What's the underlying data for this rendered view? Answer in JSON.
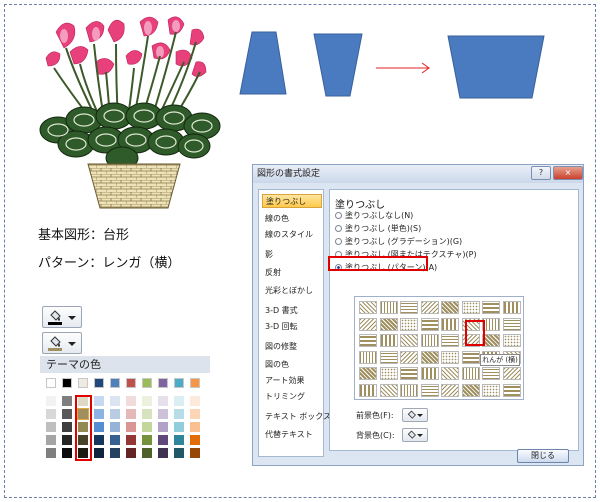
{
  "captions": {
    "shape_label": "基本図形：台形",
    "pattern_label": "パターン：レンガ（横）"
  },
  "colors": {
    "shape_fill": "#4a7abf",
    "arrow": "#e02020",
    "highlight": "#e00000",
    "pattern_fg": "#a09060"
  },
  "palette": {
    "title": "テーマの色",
    "top_row": [
      "#ffffff",
      "#000000",
      "#eeece1",
      "#1f497d",
      "#4f81bd",
      "#c0504d",
      "#9bbb59",
      "#8064a2",
      "#4bacc6",
      "#f79646"
    ],
    "shades": [
      [
        "#f2f2f2",
        "#7f7f7f",
        "#ddd9c3",
        "#c6d9f0",
        "#dbe5f1",
        "#f2dcdb",
        "#ebf1dd",
        "#e5e0ec",
        "#dbeef3",
        "#fdeada"
      ],
      [
        "#d8d8d8",
        "#595959",
        "#c4bd97",
        "#8db3e2",
        "#b8cce4",
        "#e5b9b7",
        "#d7e3bc",
        "#ccc1d9",
        "#b7dde8",
        "#fbd5b5"
      ],
      [
        "#bfbfbf",
        "#3f3f3f",
        "#938953",
        "#548dd4",
        "#95b3d7",
        "#d99694",
        "#c3d69b",
        "#b2a2c7",
        "#92cddc",
        "#fac08f"
      ],
      [
        "#a5a5a5",
        "#262626",
        "#494429",
        "#17365d",
        "#366092",
        "#953734",
        "#76923c",
        "#5f497a",
        "#31859b",
        "#e36c09"
      ],
      [
        "#7f7f7f",
        "#0c0c0c",
        "#1d1b10",
        "#0f243e",
        "#244061",
        "#632423",
        "#4f6128",
        "#3f3151",
        "#205867",
        "#974806"
      ]
    ]
  },
  "dialog": {
    "title": "図形の書式設定",
    "help_label": "?",
    "close_label": "×",
    "nav_items": [
      "塗りつぶし",
      "線の色",
      "線のスタイル",
      "影",
      "反射",
      "光彩とぼかし",
      "3-D 書式",
      "3-D 回転",
      "図の修整",
      "図の色",
      "アート効果",
      "トリミング",
      "テキスト ボックス",
      "代替テキスト"
    ],
    "pane_heading": "塗りつぶし",
    "fill_options": [
      {
        "label": "塗りつぶしなし(N)",
        "checked": false
      },
      {
        "label": "塗りつぶし (単色)(S)",
        "checked": false
      },
      {
        "label": "塗りつぶし (グラデーション)(G)",
        "checked": false
      },
      {
        "label": "塗りつぶし (図またはテクスチャ)(P)",
        "checked": false
      },
      {
        "label": "塗りつぶし (パターン)(A)",
        "checked": true
      }
    ],
    "tooltip": "れんが (横)",
    "foreground_label": "前景色(F):",
    "background_label": "背景色(C):",
    "ok_label": "閉じる"
  }
}
